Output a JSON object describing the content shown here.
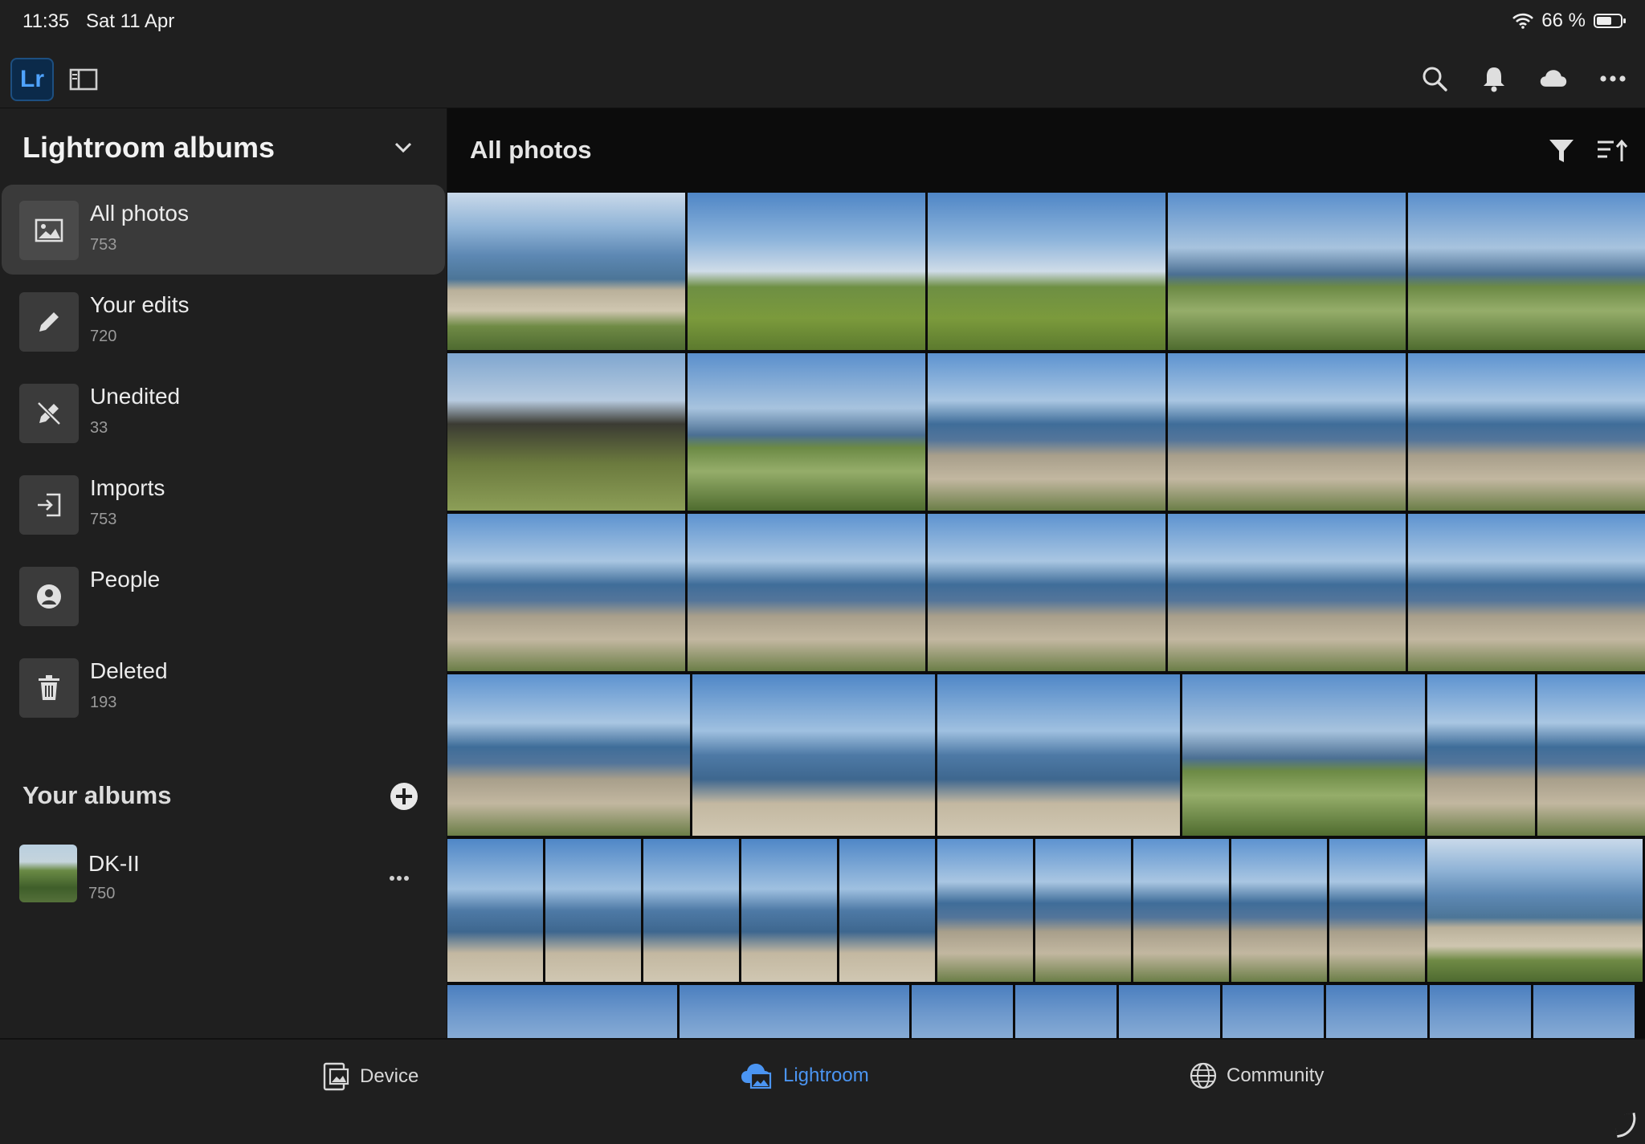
{
  "status": {
    "time": "11:35",
    "date": "Sat 11 Apr",
    "battery": "66 %",
    "battery_level": 0.66
  },
  "topbar": {
    "logo": "Lr",
    "icons": [
      "sidebar-toggle-icon",
      "search-icon",
      "bell-icon",
      "cloud-icon",
      "more-icon"
    ]
  },
  "sidebar": {
    "header": "Lightroom albums",
    "items": [
      {
        "label": "All photos",
        "count": "753",
        "icon": "photo-icon"
      },
      {
        "label": "Your edits",
        "count": "720",
        "icon": "pencil-icon"
      },
      {
        "label": "Unedited",
        "count": "33",
        "icon": "unedited-icon"
      },
      {
        "label": "Imports",
        "count": "753",
        "icon": "import-icon"
      },
      {
        "label": "People",
        "count": "",
        "icon": "person-icon"
      },
      {
        "label": "Deleted",
        "count": "193",
        "icon": "trash-icon"
      }
    ],
    "albums_header": "Your albums",
    "albums": [
      {
        "name": "DK-II",
        "count": "750"
      }
    ]
  },
  "main": {
    "title": "All photos"
  },
  "bottom_tabs": [
    {
      "label": "Device",
      "active": false
    },
    {
      "label": "Lightroom",
      "active": true
    },
    {
      "label": "Community",
      "active": false
    }
  ],
  "colors": {
    "accent": "#4b95f2",
    "background": "#1f1f1f",
    "grid_background": "#0c0c0c"
  }
}
